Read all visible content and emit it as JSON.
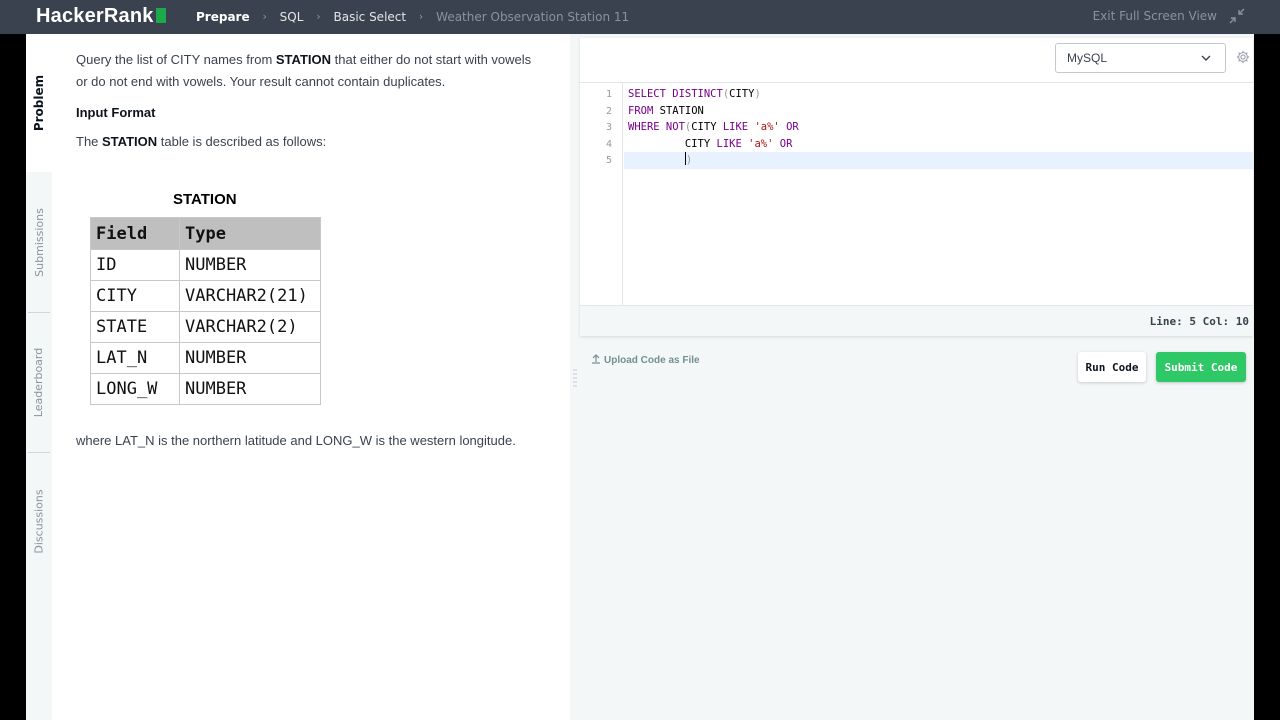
{
  "header": {
    "logo_text": "HackerRank",
    "breadcrumbs": [
      "Prepare",
      "SQL",
      "Basic Select",
      "Weather Observation Station 11"
    ],
    "exit_label": "Exit Full Screen View"
  },
  "sidebar": {
    "tabs": [
      {
        "label": "Problem",
        "active": true
      },
      {
        "label": "Submissions",
        "active": false
      },
      {
        "label": "Leaderboard",
        "active": false
      },
      {
        "label": "Discussions",
        "active": false
      }
    ]
  },
  "problem": {
    "intro_pre": "Query the list of CITY names from ",
    "intro_bold": "STATION",
    "intro_post": " that either do not start with vowels or do not end with vowels. Your result cannot contain duplicates.",
    "input_format_heading": "Input Format",
    "table_desc_pre": "The ",
    "table_desc_bold": "STATION",
    "table_desc_post": " table is described as follows:",
    "table_title": "STATION",
    "table_headers": [
      "Field",
      "Type"
    ],
    "table_rows": [
      [
        "ID",
        "NUMBER"
      ],
      [
        "CITY",
        "VARCHAR2(21)"
      ],
      [
        "STATE",
        "VARCHAR2(2)"
      ],
      [
        "LAT_N",
        "NUMBER"
      ],
      [
        "LONG_W",
        "NUMBER"
      ]
    ],
    "footnote": "where LAT_N is the northern latitude and LONG_W is the western longitude."
  },
  "editor": {
    "language": "MySQL",
    "line_numbers": [
      "1",
      "2",
      "3",
      "4",
      "5"
    ],
    "code": {
      "l1_kw": "SELECT DISTINCT",
      "l1_open": "(",
      "l1_col": "CITY",
      "l1_close": ")",
      "l2_kw": "FROM",
      "l2_tbl": " STATION",
      "l3_kw": "WHERE NOT",
      "l3_open": "(",
      "l3_col": "CITY ",
      "l3_like": "LIKE",
      "l3_str": " 'a%'",
      "l3_or": " OR",
      "l4_indent": "         ",
      "l4_col": "CITY ",
      "l4_like": "LIKE",
      "l4_str": " 'a%'",
      "l4_or": " OR",
      "l5_indent": "         ",
      "l5_close": ")"
    },
    "status": "Line: 5 Col: 10"
  },
  "actions": {
    "upload_label": "Upload Code as File",
    "run_label": "Run Code",
    "submit_label": "Submit Code"
  },
  "icons": {
    "exit_fullscreen": "collapse-arrows-icon",
    "settings": "gear-icon",
    "dropdown": "chevron-down-icon",
    "upload": "upload-arrow-icon"
  },
  "colors": {
    "topbar": "#39424e",
    "brand_green": "#1ba94c",
    "submit_green": "#2ec866",
    "keyword": "#770088",
    "string": "#aa1111"
  }
}
